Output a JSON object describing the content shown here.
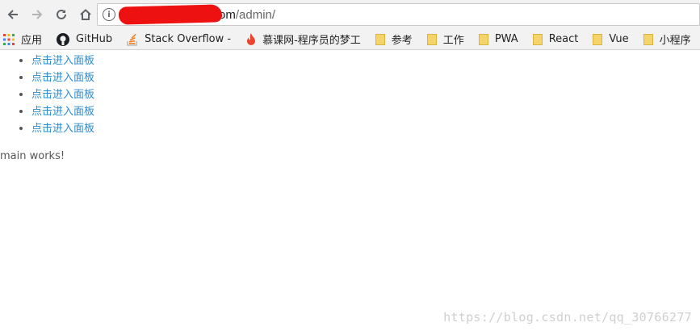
{
  "toolbar": {
    "back_icon": "arrow-left-icon",
    "forward_icon": "arrow-right-icon",
    "reload_icon": "reload-icon",
    "home_icon": "home-icon",
    "url_host_tail": "om",
    "url_path": "/admin/"
  },
  "bookmarks": [
    {
      "label": "应用",
      "icon": "apps-grid-icon"
    },
    {
      "label": "GitHub",
      "icon": "github-icon"
    },
    {
      "label": "Stack Overflow - W",
      "icon": "stackoverflow-icon"
    },
    {
      "label": "慕课网-程序员的梦工",
      "icon": "flame-icon"
    },
    {
      "label": "参考",
      "icon": "folder-icon"
    },
    {
      "label": "工作",
      "icon": "folder-icon"
    },
    {
      "label": "PWA",
      "icon": "folder-icon"
    },
    {
      "label": "React",
      "icon": "folder-icon"
    },
    {
      "label": "Vue",
      "icon": "folder-icon"
    },
    {
      "label": "小程序",
      "icon": "folder-icon"
    }
  ],
  "menu": {
    "items": [
      "点击进入面板",
      "点击进入面板",
      "点击进入面板",
      "点击进入面板",
      "点击进入面板"
    ]
  },
  "main_text": "main works!",
  "watermark": "https://blog.csdn.net/qq_30766277",
  "colors": {
    "link": "#2a8ccf",
    "chrome": "#f2f2f2",
    "redaction": "#ee1111",
    "folder": "#f5d56b"
  }
}
